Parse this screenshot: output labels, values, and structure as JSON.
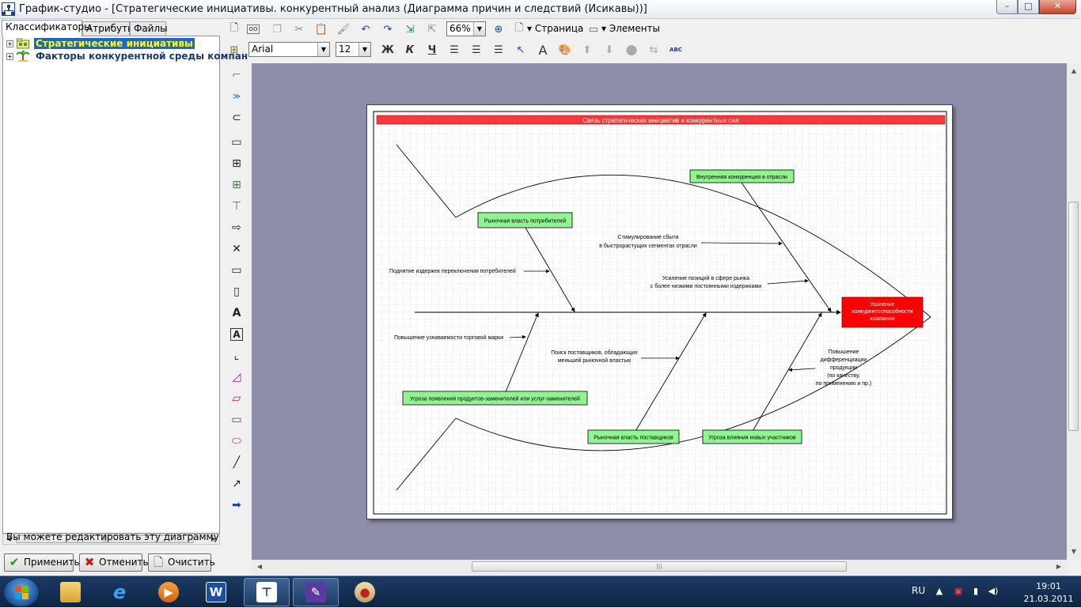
{
  "window": {
    "title": "График-студио - [Стратегические инициативы. конкурентный анализ (Диаграмма причин и следствий (Исикавы))]",
    "min_label": "–",
    "max_label": "□",
    "close_label": "✕"
  },
  "left_panel": {
    "tabs": [
      {
        "label": "Классификаторы",
        "active": true
      },
      {
        "label": "Атрибуты",
        "active": false
      },
      {
        "label": "Файлы",
        "active": false
      }
    ],
    "tree": [
      {
        "label": "Стратегические инициативы",
        "selected": true,
        "expander": "+"
      },
      {
        "label": "Факторы конкурентной среды компан",
        "selected": false,
        "expander": "+"
      }
    ],
    "hint": "Вы можете редактировать эту диаграмму",
    "buttons": {
      "apply": "Применить",
      "cancel": "Отменить",
      "clear": "Очистить"
    }
  },
  "toolbar": {
    "zoom": "66%",
    "page_label": "Страница",
    "elements_label": "Элементы",
    "font": "Arial",
    "font_size": "12",
    "bold": "Ж",
    "italic": "К",
    "underline": "Ч",
    "text_tool": "A",
    "abc": "ABC"
  },
  "diagram": {
    "title": "Связь стратегических инициатив и конкурентных сил",
    "effect": [
      "Усиление",
      "конкурентоспособности",
      "компании"
    ],
    "causes": {
      "top_left": "Рыночная власть потребителей",
      "top_right": "Внутренняя конкуренция в отрасли",
      "bottom_left": "Угроза появления продуктов-заменителей или услуг-заменителей",
      "bottom_mid": "Рыночная власть поставщиков",
      "bottom_right": "Угроза влияния новых участников"
    },
    "subcauses": {
      "switching": "Поднятие издержек переключения потребителей",
      "promo": [
        "Стимулирование сбыта",
        "в быстрорастущих сегментах отрасли"
      ],
      "market_pos": [
        "Усиление позиций в сфере рынка",
        "с более низкими постоянными издержками"
      ],
      "brand": "Повышение узнаваемости торговой марки",
      "suppliers": [
        "Поиск поставщиков, обладающих",
        "меньшей рыночной властью"
      ],
      "differentiation": [
        "Повышение",
        "дифференциации",
        "продукции",
        "(по качеству,",
        "по применению и пр.)"
      ]
    },
    "colors": {
      "title_bar": "#f03c3c",
      "effect_box": "#ff0000",
      "cause_box": "#90f590"
    }
  },
  "taskbar": {
    "lang": "RU",
    "time": "19:01",
    "date": "21.03.2011"
  }
}
